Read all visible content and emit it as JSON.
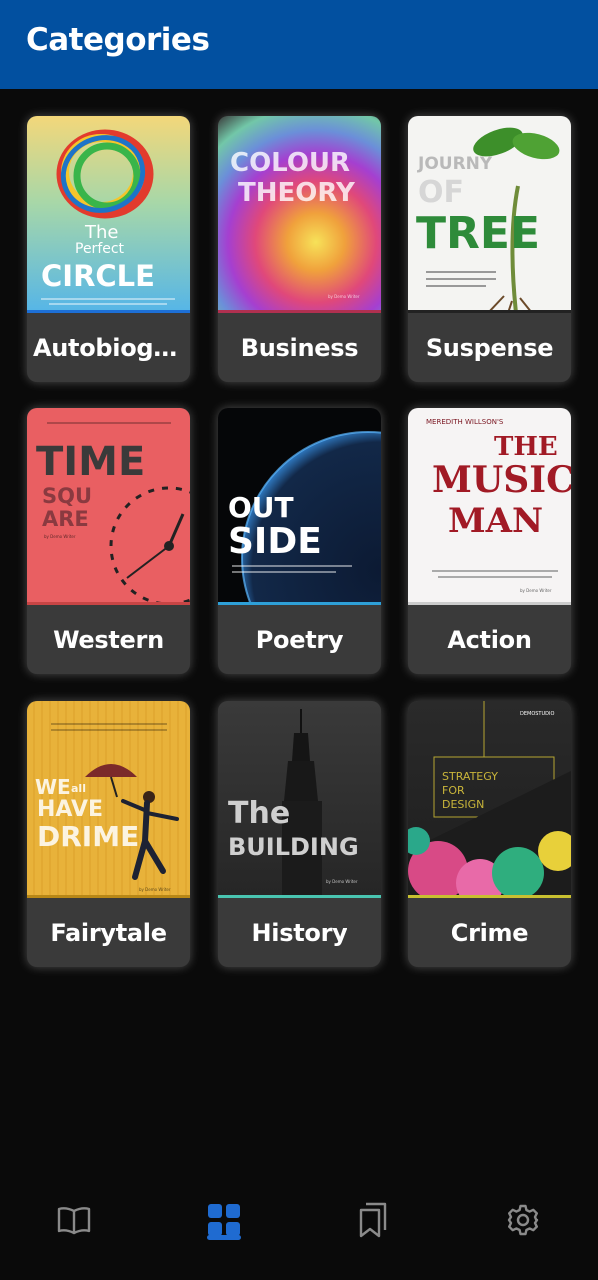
{
  "appbar": {
    "title": "Categories"
  },
  "categories": [
    {
      "label": "Autobiogr...",
      "cover": {
        "line1": "The",
        "line2": "Perfect",
        "line3": "CIRCLE"
      }
    },
    {
      "label": "Business",
      "cover": {
        "line1": "COLOUR",
        "line2": "THEORY",
        "byline": "by Demo Writer"
      }
    },
    {
      "label": "Suspense",
      "cover": {
        "line1": "JOURNY",
        "line2": "OF",
        "line3": "TREE"
      }
    },
    {
      "label": "Western",
      "cover": {
        "line1": "TIME",
        "line2": "SQU",
        "line3": "ARE",
        "byline": "by Demo Writer"
      }
    },
    {
      "label": "Poetry",
      "cover": {
        "line1": "OUT",
        "line2": "SIDE"
      }
    },
    {
      "label": "Action",
      "cover": {
        "top": "MEREDITH WILLSON'S",
        "line1": "THE",
        "line2": "MUSIC",
        "line3": "MAN",
        "byline": "by Demo Writer"
      }
    },
    {
      "label": "Fairytale",
      "cover": {
        "line1": "WE",
        "line1b": "all",
        "line2": "HAVE",
        "line3": "DRIME",
        "byline": "by Demo Writer"
      }
    },
    {
      "label": "History",
      "cover": {
        "line1": "The",
        "line2": "BUILDING",
        "byline": "by Demo Writer"
      }
    },
    {
      "label": "Crime",
      "cover": {
        "top": "DEMOSTUDIO",
        "line1": "STRATEGY",
        "line2": "FOR",
        "line3": "DESIGN"
      }
    }
  ],
  "bottom_nav": {
    "items": [
      {
        "icon": "book-open-icon",
        "active": false
      },
      {
        "icon": "grid-icon",
        "active": true
      },
      {
        "icon": "bookmarks-icon",
        "active": false
      },
      {
        "icon": "gear-icon",
        "active": false
      }
    ],
    "accent": "#1f6bd1"
  },
  "colors": {
    "appbar": "#0250a0",
    "background": "#0a0a0a",
    "card": "#3a3a3a"
  }
}
